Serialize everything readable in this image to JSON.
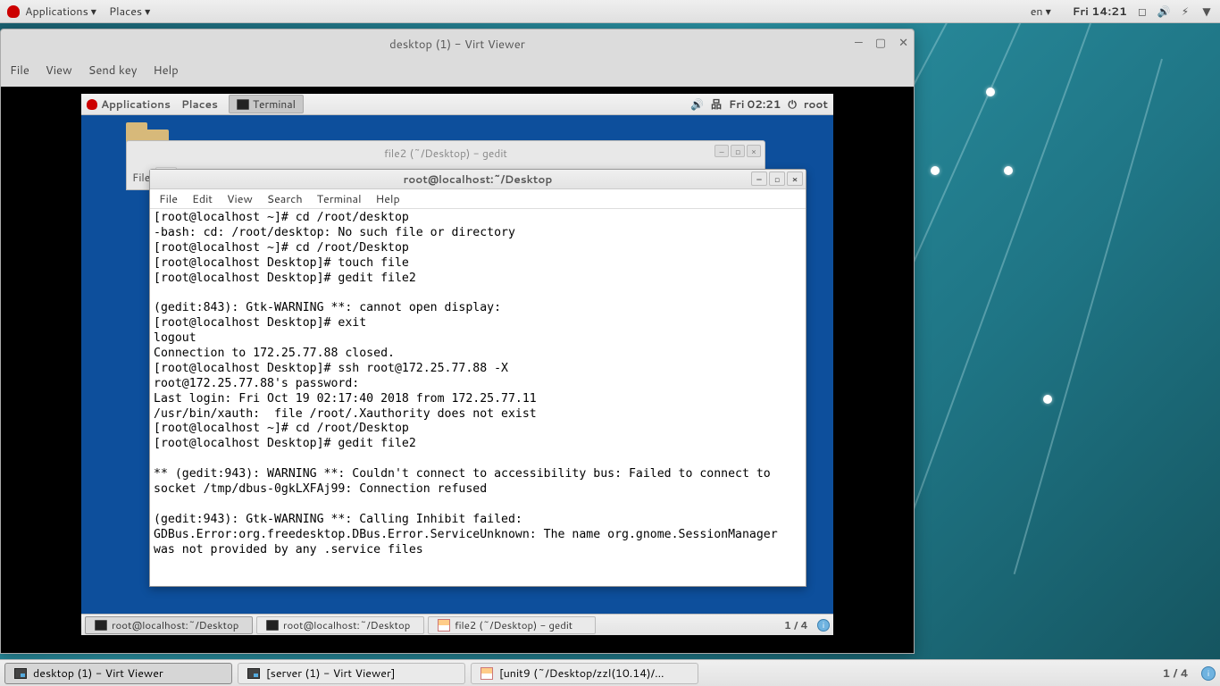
{
  "host_panel": {
    "applications": "Applications",
    "places": "Places",
    "lang": "en",
    "clock": "Fri 14:21"
  },
  "vv": {
    "title": "desktop (1) - Virt Viewer",
    "menu": {
      "file": "File",
      "view": "View",
      "sendkey": "Send key",
      "help": "Help"
    }
  },
  "guest_panel": {
    "applications": "Applications",
    "places": "Places",
    "task_term": "Terminal",
    "clock": "Fri 02:21",
    "user": "root"
  },
  "gedit_back": {
    "title": "file2 (~/Desktop) - gedit",
    "file_label": "File"
  },
  "term": {
    "title": "root@localhost:~/Desktop",
    "menu": {
      "file": "File",
      "edit": "Edit",
      "view": "View",
      "search": "Search",
      "terminal": "Terminal",
      "help": "Help"
    },
    "body": "[root@localhost ~]# cd /root/desktop\n-bash: cd: /root/desktop: No such file or directory\n[root@localhost ~]# cd /root/Desktop\n[root@localhost Desktop]# touch file\n[root@localhost Desktop]# gedit file2\n\n(gedit:843): Gtk-WARNING **: cannot open display:\n[root@localhost Desktop]# exit\nlogout\nConnection to 172.25.77.88 closed.\n[root@localhost Desktop]# ssh root@172.25.77.88 -X\nroot@172.25.77.88's password:\nLast login: Fri Oct 19 02:17:40 2018 from 172.25.77.11\n/usr/bin/xauth:  file /root/.Xauthority does not exist\n[root@localhost ~]# cd /root/Desktop\n[root@localhost Desktop]# gedit file2\n\n** (gedit:943): WARNING **: Couldn't connect to accessibility bus: Failed to connect to socket /tmp/dbus-0gkLXFAj99: Connection refused\n\n(gedit:943): Gtk-WARNING **: Calling Inhibit failed: GDBus.Error:org.freedesktop.DBus.Error.ServiceUnknown: The name org.gnome.SessionManager was not provided by any .service files"
  },
  "guest_taskbar": {
    "t1": "root@localhost:~/Desktop",
    "t2": "root@localhost:~/Desktop",
    "t3": "file2 (~/Desktop) - gedit",
    "ws": "1 / 4"
  },
  "host_taskbar": {
    "t1": "desktop (1) - Virt Viewer",
    "t2": "[server (1) - Virt Viewer]",
    "t3": "[unit9 (~/Desktop/zzl(10.14)/...",
    "ws": "1 / 4"
  }
}
